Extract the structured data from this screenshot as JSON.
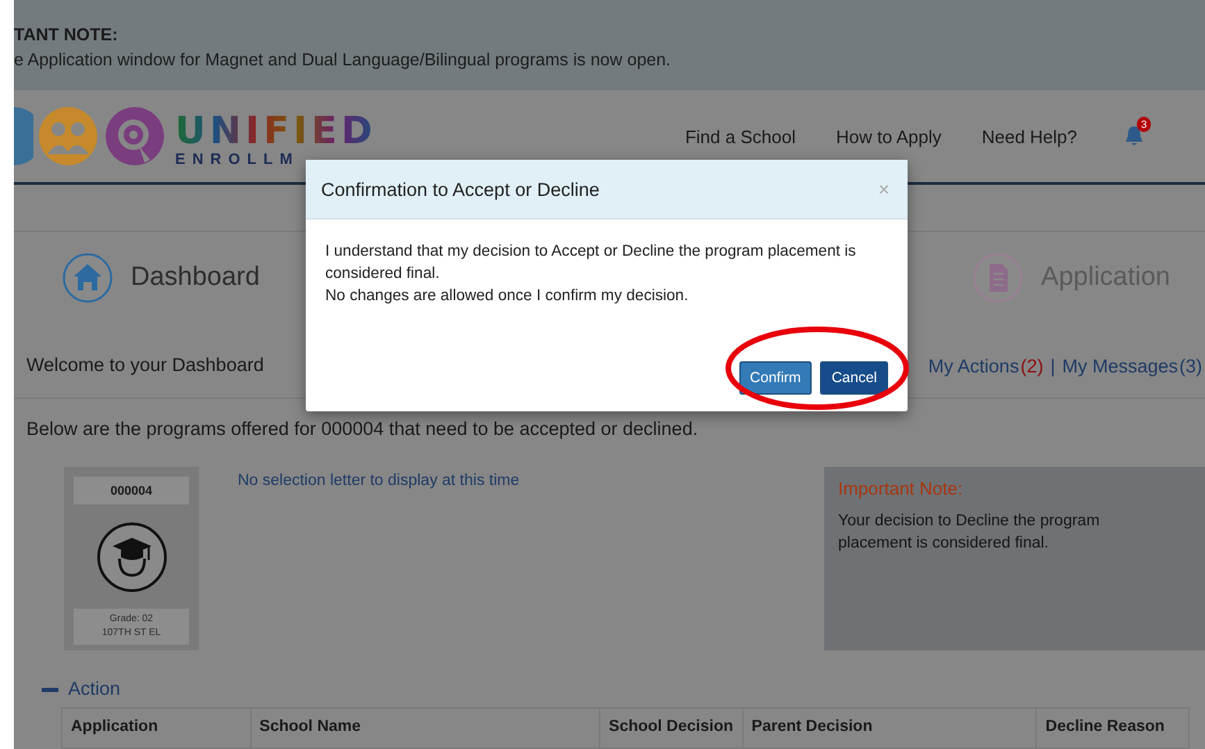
{
  "notice": {
    "title": "TANT NOTE:",
    "text": "e Application window for Magnet and Dual Language/Bilingual programs is now open."
  },
  "logo": {
    "word": "UNIFIED",
    "subword": "ENROLLM"
  },
  "nav": [
    {
      "label": "Find a School"
    },
    {
      "label": "How to Apply"
    },
    {
      "label": "Need Help?"
    }
  ],
  "notifications": {
    "count": "3"
  },
  "sections": [
    {
      "label": "Dashboard",
      "kind": "home"
    },
    {
      "label": "Application",
      "kind": "document"
    }
  ],
  "welcome": "Welcome to your Dashboard",
  "link_separator": "|",
  "links": [
    {
      "label": "My Actions",
      "count": "(2)",
      "alert": true
    },
    {
      "label": "My Messages",
      "count": "(3)",
      "alert": false
    }
  ],
  "intro": "Below are the programs offered for 000004 that need to be accepted or declined.",
  "student": {
    "id": "000004",
    "grade": "Grade: 02",
    "school": "107TH ST EL"
  },
  "letter_note": "No selection letter to display at this time",
  "important": {
    "title": "Important Note:",
    "text": "Your decision to Decline the program placement is considered final."
  },
  "action": {
    "label": "Action",
    "expanded": true
  },
  "table": {
    "columns": [
      "Application",
      "School Name",
      "School Decision",
      "Parent Decision",
      "Decline Reason"
    ]
  },
  "dialog": {
    "title": "Confirmation to Accept or Decline",
    "close": "×",
    "lines": [
      "I understand that my decision to Accept or Decline the program placement is considered final.",
      "No changes are allowed once I confirm my decision."
    ],
    "buttons": [
      {
        "label": "Confirm",
        "kind": "primary"
      },
      {
        "label": "Cancel",
        "kind": "secondary"
      }
    ]
  }
}
